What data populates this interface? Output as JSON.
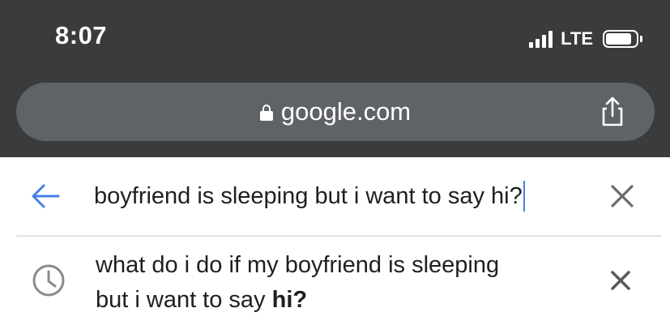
{
  "status_bar": {
    "time": "8:07",
    "network": "LTE",
    "signal_bars": 4,
    "battery_level": 0.85
  },
  "url_bar": {
    "domain": "google.com",
    "lock_icon": "lock-icon",
    "share_icon": "share-icon"
  },
  "search": {
    "back_icon": "arrow-left-icon",
    "query": "boyfriend is sleeping but i want to say hi?",
    "clear_icon": "close-icon"
  },
  "suggestions": [
    {
      "icon": "history-clock-icon",
      "line1": "what do i do if my boyfriend is sleeping",
      "line2_prefix": "but i want to say ",
      "line2_bold": "hi?",
      "remove_icon": "close-icon"
    }
  ],
  "colors": {
    "chrome_bg": "#3a3b3d",
    "url_bar_bg": "#5f6266",
    "accent_blue": "#4a7ee6",
    "icon_gray": "#8a8a8a",
    "text": "#1f1f1f"
  }
}
